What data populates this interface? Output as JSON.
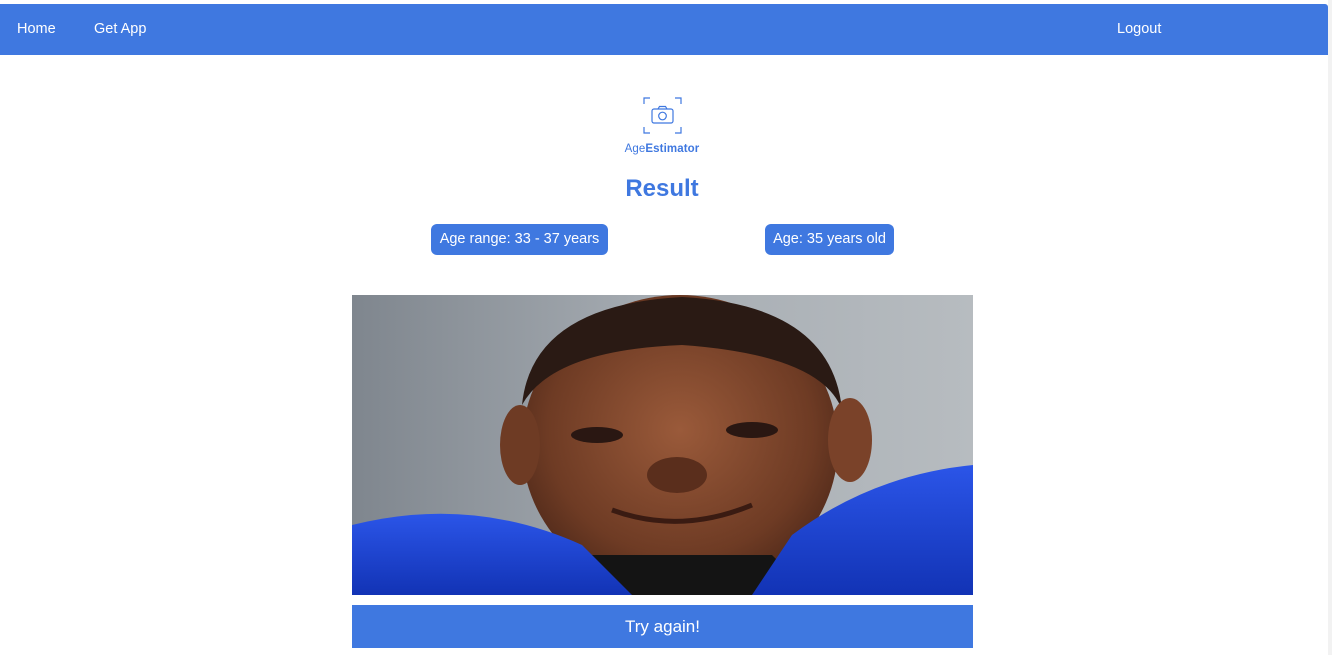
{
  "nav": {
    "home_label": "Home",
    "getapp_label": "Get App",
    "logout_label": "Logout"
  },
  "brand": {
    "logo_icon": "camera-focus-icon",
    "name_part1": "Age",
    "name_part2": "Estimator"
  },
  "result": {
    "title": "Result",
    "age_range_label": "Age range: 33 - 37 years",
    "age_label": "Age: 35 years old"
  },
  "photo": {
    "alt": "uploaded face photo"
  },
  "actions": {
    "try_again_label": "Try again!"
  },
  "colors": {
    "accent": "#3f78e0",
    "text_on_accent": "#ffffff"
  }
}
